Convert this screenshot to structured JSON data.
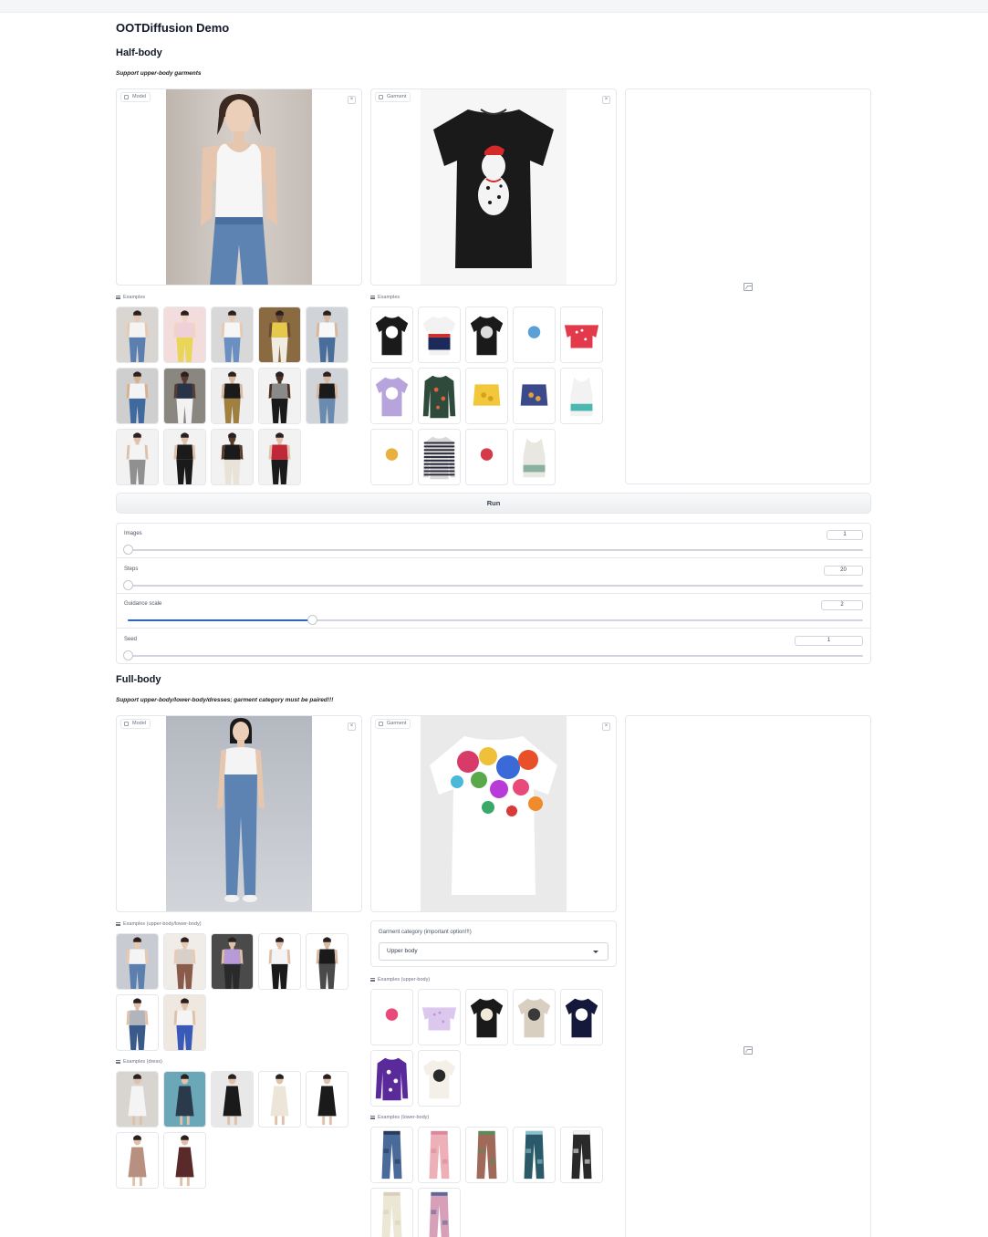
{
  "app": {
    "title": "OOTDiffusion Demo"
  },
  "half_body": {
    "heading": "Half-body",
    "note": "Support upper-body garments",
    "model_label": "Model",
    "garment_label": "Garment",
    "model_examples_label": "Examples",
    "garment_examples_label": "Examples",
    "run_label": "Run",
    "model_examples": [
      {
        "top": "#f4f4f4",
        "bottom": "#5b80b0",
        "skin": "#e8c9b0",
        "bg": "#d9d6d2"
      },
      {
        "top": "#f0d0d8",
        "bottom": "#e8d55a",
        "skin": "#f0d4c2",
        "bg": "#f2dcdc"
      },
      {
        "top": "#f6f6f6",
        "bottom": "#6a8fc0",
        "skin": "#e8c9b0",
        "bg": "#d8d8d8"
      },
      {
        "top": "#e6c84a",
        "bottom": "#f0ece2",
        "skin": "#6e4a36",
        "bg": "#8a6a40"
      },
      {
        "top": "#f8f8f8",
        "bottom": "#4a6e9a",
        "skin": "#d8b8a0",
        "bg": "#d0d4d8"
      },
      {
        "top": "#f4f4f4",
        "bottom": "#3e6a9e",
        "skin": "#d8b090",
        "bg": "#cfcfcf"
      },
      {
        "top": "#2a3448",
        "bottom": "#f2f2f2",
        "skin": "#5a3a2a",
        "bg": "#8a8680"
      },
      {
        "top": "#1a1a1a",
        "bottom": "#a08040",
        "skin": "#d8b8a0",
        "bg": "#eeeeee"
      },
      {
        "top": "#8a8a8a",
        "bottom": "#1a1a1a",
        "skin": "#4a3020",
        "bg": "#f2f2f2"
      },
      {
        "top": "#1a1a1a",
        "bottom": "#6a8ab0",
        "skin": "#d8b8a0",
        "bg": "#d0d4d8"
      },
      {
        "top": "#f4f4f4",
        "bottom": "#909090",
        "skin": "#e0c0a8",
        "bg": "#f2f2f2"
      },
      {
        "top": "#1a1a1a",
        "bottom": "#1a1a1a",
        "skin": "#e0c0a8",
        "bg": "#f2f2f2"
      },
      {
        "top": "#1a1a1a",
        "bottom": "#e8e2d8",
        "skin": "#5a3a2a",
        "bg": "#f2f2f2"
      },
      {
        "top": "#c0283a",
        "bottom": "#1a1a1a",
        "skin": "#e0c0a8",
        "bg": "#f2f2f2"
      }
    ],
    "garment_examples": [
      {
        "body": "#1a1a1a",
        "accent": "#ffffff",
        "kind": "tee"
      },
      {
        "body": "#f2f2f2",
        "accent": "#1c2a5a",
        "kind": "tee-color",
        "band": "#d42a2a"
      },
      {
        "body": "#1a1a1a",
        "accent": "#dddddd",
        "kind": "tee"
      },
      {
        "body": "#ffffff",
        "accent": "#5aa0d8",
        "kind": "tee"
      },
      {
        "body": "#e23a4a",
        "accent": "#ffffff",
        "kind": "offshoulder"
      },
      {
        "body": "#b8a4dc",
        "accent": "#ffffff",
        "kind": "tee"
      },
      {
        "body": "#2e4a3a",
        "accent": "#e06040",
        "kind": "longsleeve"
      },
      {
        "body": "#f2c83a",
        "accent": "#d4a020",
        "kind": "crop"
      },
      {
        "body": "#3a4a8a",
        "accent": "#e0a040",
        "kind": "crop"
      },
      {
        "body": "#f2f2f2",
        "accent": "#4ab8b0",
        "kind": "tank"
      },
      {
        "body": "#ffffff",
        "accent": "#e8b040",
        "kind": "tee"
      },
      {
        "body": "#d8d8d8",
        "accent": "#2a2a3a",
        "kind": "stripes"
      },
      {
        "body": "#ffffff",
        "accent": "#d43a4a",
        "kind": "tee"
      },
      {
        "body": "#e8e8e0",
        "accent": "#8ab0a0",
        "kind": "tank"
      }
    ],
    "sliders": [
      {
        "label": "Images",
        "value": "1",
        "pct": 0,
        "accent": false,
        "box": 40
      },
      {
        "label": "Steps",
        "value": "20",
        "pct": 0,
        "accent": false,
        "box": 43
      },
      {
        "label": "Guidance scale",
        "value": "2",
        "pct": 25,
        "accent": true,
        "box": 46
      },
      {
        "label": "Seed",
        "value": "1",
        "pct": 0,
        "accent": false,
        "box": 75
      }
    ]
  },
  "full_body": {
    "heading": "Full-body",
    "note": "Support upper-body/lower-body/dresses; garment category must be paired!!!",
    "model_label": "Model",
    "garment_label": "Garment",
    "examples_upper_lower_label": "Examples (upper-body/lower-body)",
    "examples_dress_label": "Examples (dress)",
    "category_label": "Garment category (important option!!!)",
    "category_value": "Upper body",
    "examples_upper_label": "Examples (upper-body)",
    "examples_lower_label": "Examples (lower-body)",
    "model_examples": [
      {
        "top": "#f4f4f4",
        "bottom": "#5b80b0",
        "skin": "#e8c9b0",
        "bg": "#c8ccd2"
      },
      {
        "top": "#d8d0c8",
        "bottom": "#8a5a4a",
        "skin": "#e8c9b0",
        "bg": "#f0ece8"
      },
      {
        "top": "#b89ad8",
        "bottom": "#2a2a2a",
        "skin": "#e0c0a8",
        "bg": "#4a4a4a"
      },
      {
        "top": "#f4f4f4",
        "bottom": "#1a1a1a",
        "skin": "#e0c0a8",
        "bg": "#ffffff"
      },
      {
        "top": "#1a1a1a",
        "bottom": "#4a4a4a",
        "skin": "#d8b8a0",
        "bg": "#ffffff"
      },
      {
        "top": "#b0b4bc",
        "bottom": "#3a5a8a",
        "skin": "#e0c0a8",
        "bg": "#ffffff"
      },
      {
        "top": "#f4f4f4",
        "bottom": "#3a5ab8",
        "skin": "#e0c0a8",
        "bg": "#efe8e0"
      }
    ],
    "dress_examples": [
      {
        "body": "#f4f4f4",
        "skin": "#e0c0a8",
        "bg": "#d8d4d0"
      },
      {
        "body": "#2a3a4a",
        "skin": "#e0c0a8",
        "bg": "#6aa8b8"
      },
      {
        "body": "#1a1a1a",
        "skin": "#e0c0a8",
        "bg": "#e8e8e8"
      },
      {
        "body": "#ece6d8",
        "skin": "#e0c0a8",
        "bg": "#ffffff"
      },
      {
        "body": "#1a1a1a",
        "skin": "#e0c0a8",
        "bg": "#ffffff"
      },
      {
        "body": "#b89080",
        "skin": "#e0c0a8",
        "bg": "#ffffff"
      },
      {
        "body": "#5a2a2a",
        "skin": "#e0c0a8",
        "bg": "#ffffff"
      }
    ],
    "upper_examples": [
      {
        "body": "#ffffff",
        "accent": "#e84a7a",
        "kind": "tee"
      },
      {
        "body": "#dcc8ec",
        "accent": "#b89ad8",
        "kind": "offshoulder"
      },
      {
        "body": "#1a1a1a",
        "accent": "#f0e8d8",
        "kind": "tee"
      },
      {
        "body": "#d8cfc0",
        "accent": "#3a3a3a",
        "kind": "tee"
      },
      {
        "body": "#14183a",
        "accent": "#ffffff",
        "kind": "tee"
      },
      {
        "body": "#5a2a9a",
        "accent": "#ffffff",
        "kind": "longsleeve"
      },
      {
        "body": "#f4f0e8",
        "accent": "#2a2a2a",
        "kind": "tee"
      }
    ],
    "lower_examples": [
      {
        "body": "#4a6a9a",
        "accent": "#2a3a5a"
      },
      {
        "body": "#eeb0b8",
        "accent": "#d88a9a"
      },
      {
        "body": "#a06a5a",
        "accent": "#5a8a5a"
      },
      {
        "body": "#2a5a6a",
        "accent": "#8ac0c8"
      },
      {
        "body": "#2a2a2a",
        "accent": "#f2f2f2"
      },
      {
        "body": "#ece6d4",
        "accent": "#d8d0bc"
      },
      {
        "body": "#d8a0b8",
        "accent": "#5a6a9a"
      }
    ]
  },
  "colors": {
    "accent": "#2563eb",
    "border": "#e5e7eb",
    "text": "#1f2937"
  }
}
